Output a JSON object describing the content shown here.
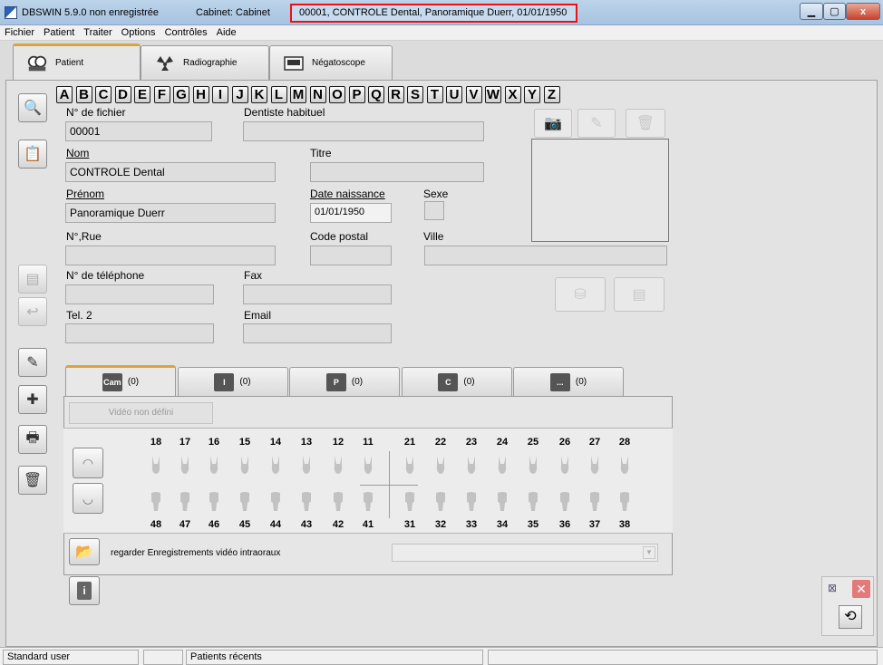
{
  "window": {
    "app_title": "DBSWIN 5.9.0 non enregistrée",
    "cabinet": "Cabinet: Cabinet",
    "patient_header": "00001, CONTROLE Dental, Panoramique Duerr, 01/01/1950"
  },
  "menu": [
    "Fichier",
    "Patient",
    "Traiter",
    "Options",
    "Contrôles",
    "Aide"
  ],
  "top_tabs": [
    {
      "label": "Patient",
      "icon": "patient-icon"
    },
    {
      "label": "Radiographie",
      "icon": "radiation-icon"
    },
    {
      "label": "Négatoscope",
      "icon": "viewer-icon"
    }
  ],
  "alphabet": [
    "A",
    "B",
    "C",
    "D",
    "E",
    "F",
    "G",
    "H",
    "I",
    "J",
    "K",
    "L",
    "M",
    "N",
    "O",
    "P",
    "Q",
    "R",
    "S",
    "T",
    "U",
    "V",
    "W",
    "X",
    "Y",
    "Z"
  ],
  "form": {
    "file_no_label": "N° de fichier",
    "file_no_value": "00001",
    "dentist_label": "Dentiste habituel",
    "dentist_value": "",
    "nom_label": "Nom",
    "nom_value": "CONTROLE Dental",
    "titre_label": "Titre",
    "titre_value": "",
    "prenom_label": "Prénom",
    "prenom_value": "Panoramique Duerr",
    "dob_label": "Date naissance",
    "dob_value": "01/01/1950",
    "sexe_label": "Sexe",
    "rue_label": "N°,Rue",
    "rue_value": "",
    "cp_label": "Code postal",
    "cp_value": "",
    "ville_label": "Ville",
    "ville_value": "",
    "tel_label": "N° de téléphone",
    "tel_value": "",
    "fax_label": "Fax",
    "fax_value": "",
    "tel2_label": "Tel. 2",
    "tel2_value": "",
    "email_label": "Email",
    "email_value": ""
  },
  "media_tabs": [
    {
      "icon_text": "Cam",
      "count": "(0)"
    },
    {
      "icon_text": "I",
      "count": "(0)"
    },
    {
      "icon_text": "P",
      "count": "(0)"
    },
    {
      "icon_text": "C",
      "count": "(0)"
    },
    {
      "icon_text": "...",
      "count": "(0)"
    }
  ],
  "video_button": "Vidéo non défini",
  "teeth_upper": [
    "18",
    "17",
    "16",
    "15",
    "14",
    "13",
    "12",
    "11",
    "21",
    "22",
    "23",
    "24",
    "25",
    "26",
    "27",
    "28"
  ],
  "teeth_lower": [
    "48",
    "47",
    "46",
    "45",
    "44",
    "43",
    "42",
    "41",
    "31",
    "32",
    "33",
    "34",
    "35",
    "36",
    "37",
    "38"
  ],
  "intraoral_label": "regarder Enregistrements vidéo intraoraux",
  "status": {
    "user": "Standard user",
    "recent": "Patients récents"
  },
  "colors": {
    "highlight_border": "#e11111",
    "tab_accent": "#d9a440",
    "close_red": "#c7442e"
  }
}
